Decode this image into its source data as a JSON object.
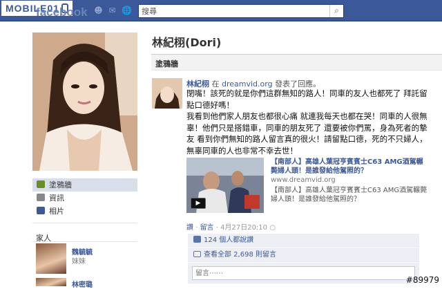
{
  "topbar": {
    "site_logo_text": "MOBILE01",
    "facebook_text": "facebook",
    "search_placeholder": "搜尋",
    "icons": [
      "friend-requests-icon",
      "messages-icon",
      "notifications-icon",
      "search-icon"
    ]
  },
  "profile": {
    "name": "林紀栩(Dori)",
    "section_title": "塗鴉牆"
  },
  "leftnav": {
    "items": [
      {
        "label": "塗鴉牆",
        "icon": "wall-icon",
        "active": true
      },
      {
        "label": "資訊",
        "icon": "info-icon",
        "active": false
      },
      {
        "label": "相片",
        "icon": "photos-icon",
        "active": false
      }
    ],
    "family_header": "家人",
    "family": [
      {
        "name": "魏毓毓",
        "relation": "妹妹"
      },
      {
        "name": "林密璐",
        "relation": ""
      }
    ]
  },
  "post": {
    "author": "林紀栩",
    "via_prefix": "在",
    "via_site": "dreamvid.org",
    "action": "發表了回應。",
    "body": "閉嘴！該死的就是你們這群無知的路人！同車的友人也都死了 拜託留點口德好嗎！\n我看到他們家人朋友也都很心痛 就連我每天也都在哭！同車的人很無辜！他們只是搭錯車，同車的朋友死了 還要被你們罵，身為死者的摯友 看到你們無知的路人留言真的很火！請留點口德，死的不只婦人，無辜同車的人也非常不幸去世！",
    "shared": {
      "title": "【南部人】高雄人葉冠亨賓賓士C63 AMG酒駕輾斃婦人頭！是誰發給他駕照的？",
      "url": "www.dreamvid.org",
      "description": "【南部人】高雄人葉冠亨賓賓士C63 AMG酒駕輾斃婦人頭！是誰發給他駕照的？"
    },
    "meta": {
      "like_label": "讚",
      "separator": "·",
      "comment_label": "留言",
      "timestamp": "4月27日20:10",
      "icon": "globe-icon"
    },
    "likes_text": "124 個人都說讚",
    "view_comments_text": "查看全部 2,698 則留言",
    "comment_placeholder": "留言⋯⋯"
  },
  "watermark": "#89979",
  "colors": {
    "brand": "#3b5998",
    "wall_bar": "#f2f2f2",
    "feedback_bg": "#edeff4"
  }
}
